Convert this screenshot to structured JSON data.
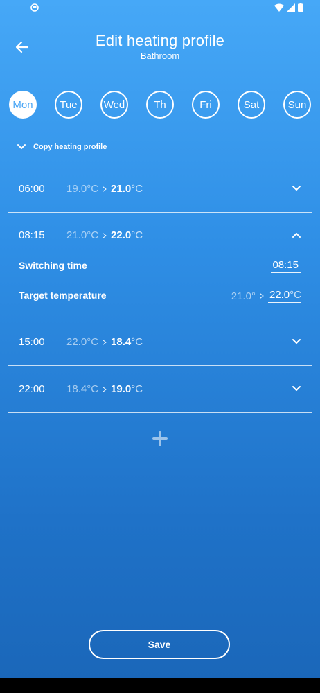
{
  "header": {
    "title": "Edit heating profile",
    "subtitle": "Bathroom",
    "back_icon": "arrow-left-icon"
  },
  "days": [
    {
      "label": "Mon",
      "selected": true
    },
    {
      "label": "Tue",
      "selected": false
    },
    {
      "label": "Wed",
      "selected": false
    },
    {
      "label": "Th",
      "selected": false
    },
    {
      "label": "Fri",
      "selected": false
    },
    {
      "label": "Sat",
      "selected": false
    },
    {
      "label": "Sun",
      "selected": false
    }
  ],
  "copy_profile": {
    "label": "Copy heating profile",
    "icon": "chevron-down-icon"
  },
  "entries": [
    {
      "time": "06:00",
      "from": "19.0°C",
      "to_value": "21.0",
      "to_unit": "°C",
      "expanded": false
    },
    {
      "time": "08:15",
      "from": "21.0°C",
      "to_value": "22.0",
      "to_unit": "°C",
      "expanded": true
    },
    {
      "time": "15:00",
      "from": "22.0°C",
      "to_value": "18.4",
      "to_unit": "°C",
      "expanded": false
    },
    {
      "time": "22:00",
      "from": "18.4°C",
      "to_value": "19.0",
      "to_unit": "°C",
      "expanded": false
    }
  ],
  "detail": {
    "switching_time_label": "Switching time",
    "switching_time_value": "08:15",
    "target_temp_label": "Target temperature",
    "target_temp_old": "21.0°",
    "target_temp_new": "22.0",
    "target_temp_unit": "°C"
  },
  "add_icon": "plus-icon",
  "save_label": "Save",
  "colors": {
    "accent": "#4aa6f5",
    "background_top": "#46a8f7",
    "background_bottom": "#1a66b8"
  }
}
